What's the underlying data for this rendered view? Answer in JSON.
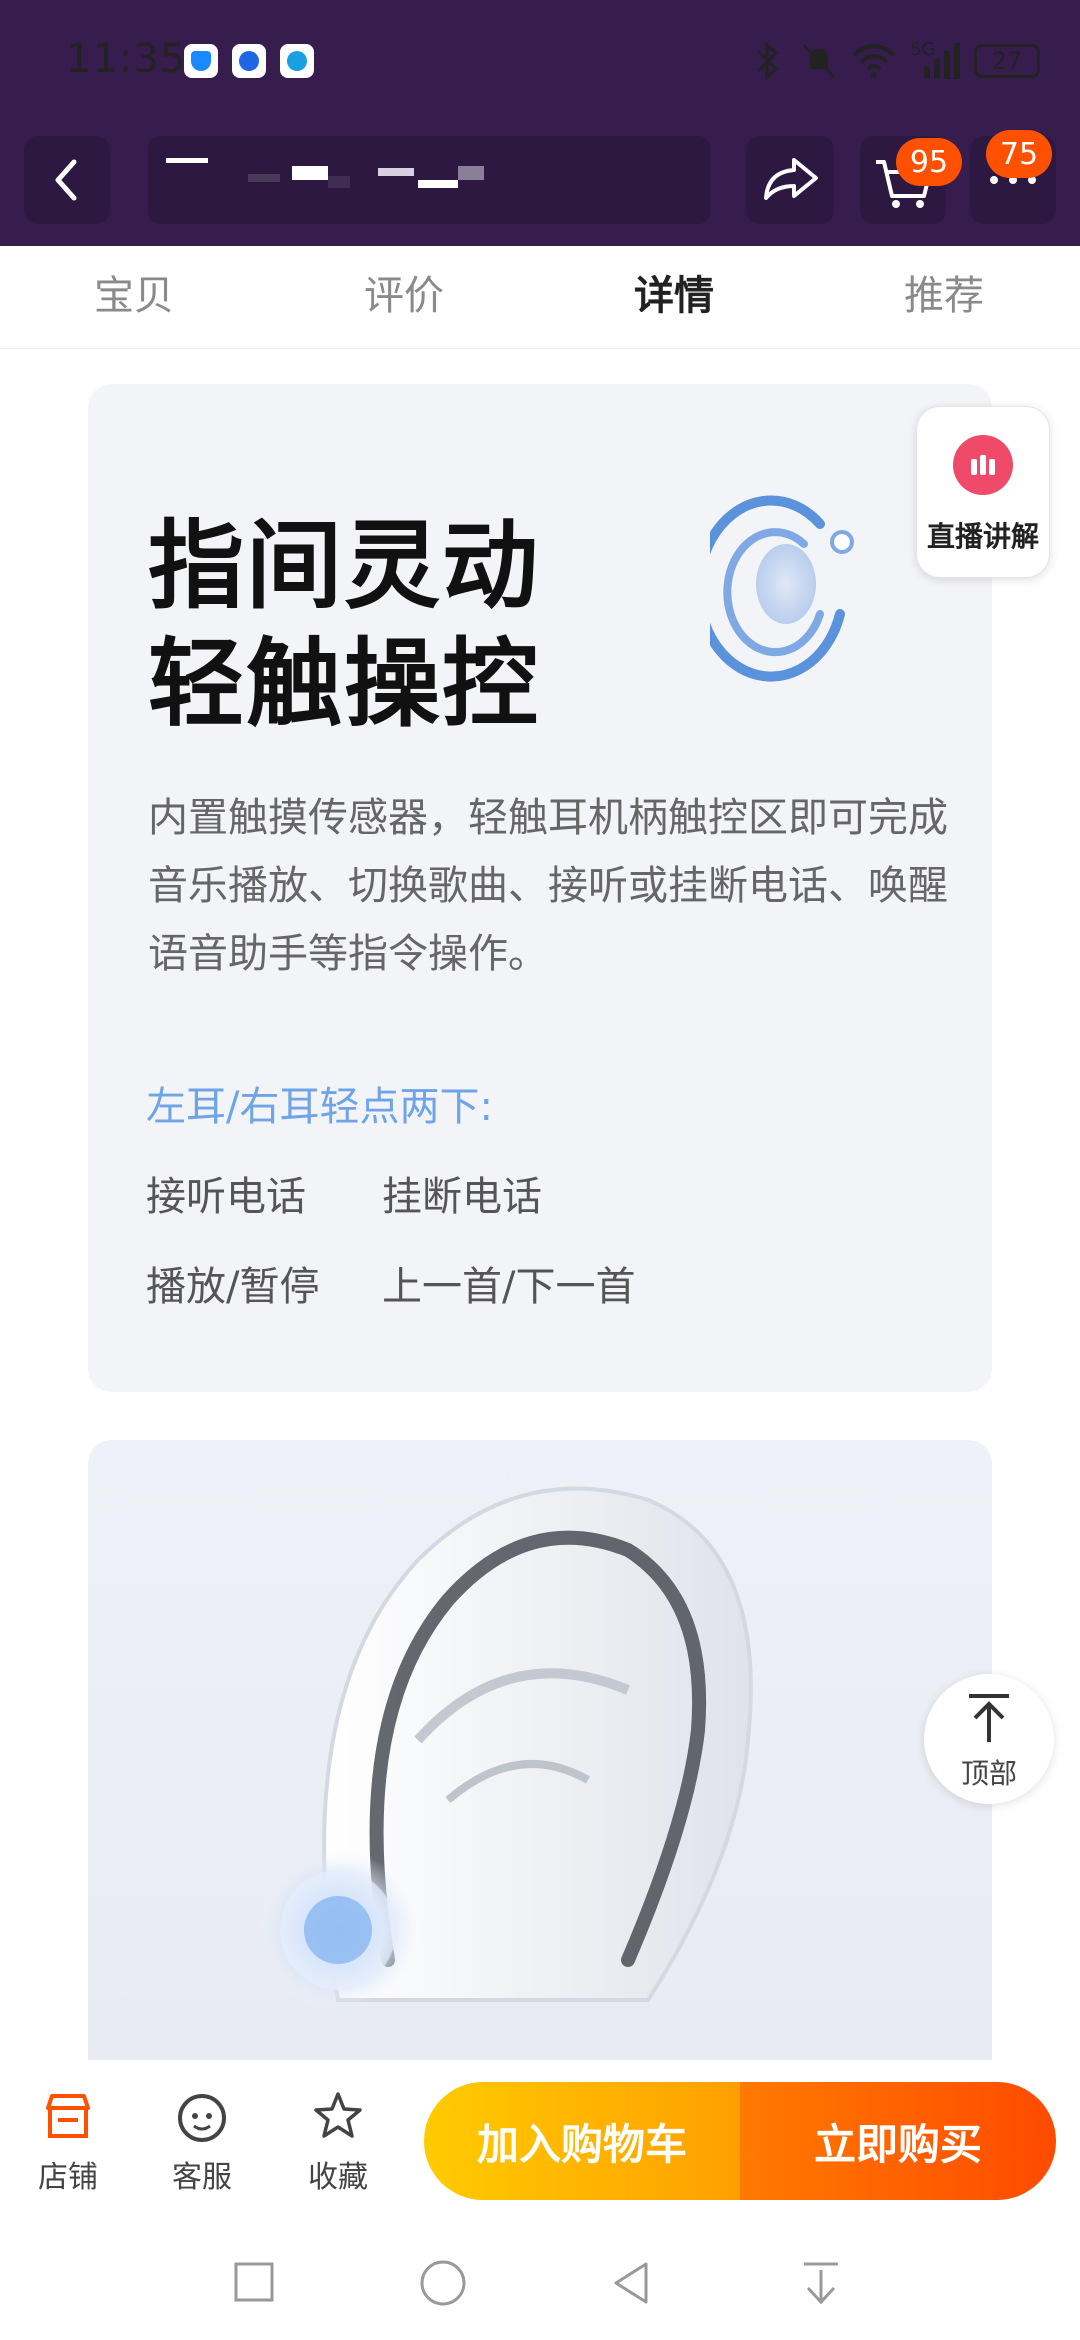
{
  "status_bar": {
    "time": "11:35",
    "network": "5G",
    "battery": "27"
  },
  "header": {
    "cart_count": "95",
    "more_count": "75"
  },
  "tabs": [
    {
      "label": "宝贝",
      "active": false
    },
    {
      "label": "评价",
      "active": false
    },
    {
      "label": "详情",
      "active": true
    },
    {
      "label": "推荐",
      "active": false
    }
  ],
  "feature_card": {
    "headline_line1": "指间灵动",
    "headline_line2": "轻触操控",
    "description": "内置触摸传感器，轻触耳机柄触控区即可完成音乐播放、切换歌曲、接听或挂断电话、唤醒语音助手等指令操作。",
    "hint": "左耳/右耳轻点两下:",
    "commands": [
      "接听电话",
      "挂断电话",
      "播放/暂停",
      "上一首/下一首"
    ]
  },
  "floating": {
    "live_label": "直播讲解",
    "top_label": "顶部"
  },
  "bottom_bar": {
    "shop_label": "店铺",
    "service_label": "客服",
    "favorite_label": "收藏",
    "add_to_cart_label": "加入购物车",
    "buy_now_label": "立即购买"
  },
  "colors": {
    "header_bg": "#361d4e",
    "accent": "#ff5000",
    "hint_blue": "#6fa4e6"
  }
}
